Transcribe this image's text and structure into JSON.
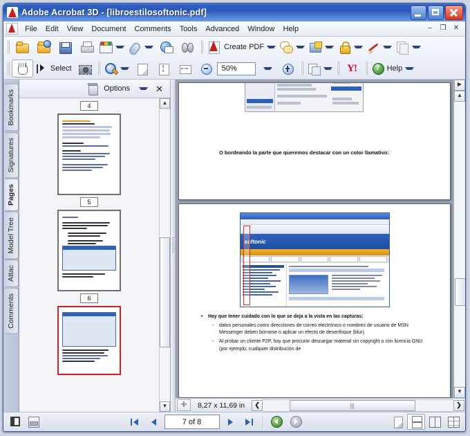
{
  "window": {
    "title": "Adobe Acrobat 3D - [libroestilosoftonic.pdf]",
    "app_icon": "acrobat-icon",
    "minimize": "–",
    "maximize": "□",
    "close": "✕",
    "mdi_minimize": "–",
    "mdi_restore": "❐",
    "mdi_close": "✕"
  },
  "menubar": {
    "items": [
      {
        "label": "File"
      },
      {
        "label": "Edit"
      },
      {
        "label": "View"
      },
      {
        "label": "Document"
      },
      {
        "label": "Comments"
      },
      {
        "label": "Tools"
      },
      {
        "label": "Advanced"
      },
      {
        "label": "Window"
      },
      {
        "label": "Help"
      }
    ]
  },
  "toolbar_file": {
    "buttons": [
      {
        "name": "open-button",
        "icon": "open-folder-icon",
        "label": ""
      },
      {
        "name": "organizer-button",
        "icon": "organizer-folder-icon",
        "label": ""
      },
      {
        "name": "save-button",
        "icon": "save-floppy-icon",
        "label": ""
      },
      {
        "name": "print-button",
        "icon": "printer-icon",
        "label": ""
      },
      {
        "name": "email-button",
        "icon": "email-icon",
        "label": ""
      },
      {
        "name": "attach-button",
        "icon": "paperclip-icon",
        "label": ""
      },
      {
        "name": "web-capture-button",
        "icon": "globe-icon",
        "label": ""
      },
      {
        "name": "search-button",
        "icon": "binoculars-icon",
        "label": ""
      }
    ],
    "create_pdf_label": "Create PDF",
    "tasks": [
      {
        "name": "review-and-comment-button",
        "icon": "review-comment-icon"
      },
      {
        "name": "stamp-button",
        "icon": "stamp-icon"
      },
      {
        "name": "secure-button",
        "icon": "lock-icon"
      },
      {
        "name": "sign-button",
        "icon": "pen-icon"
      },
      {
        "name": "forms-button",
        "icon": "forms-icon"
      }
    ]
  },
  "toolbar_view": {
    "hand_tool": {
      "name": "hand-tool",
      "icon": "hand-icon"
    },
    "select_label": "Select",
    "snapshot": {
      "name": "snapshot-tool",
      "icon": "camera-icon"
    },
    "zoom_tool": {
      "name": "zoom-in-tool",
      "icon": "magnifier-icon"
    },
    "actual_size": {
      "name": "actual-size-button",
      "icon": "page-icon"
    },
    "fit_page": {
      "name": "fit-page-button",
      "icon": "fit-page-icon"
    },
    "fit_width": {
      "name": "fit-width-button",
      "icon": "fit-width-icon"
    },
    "zoom_out": {
      "name": "zoom-out-button",
      "icon": "minus-circle-icon"
    },
    "zoom_value": "50%",
    "zoom_in": {
      "name": "zoom-in-button",
      "icon": "plus-circle-icon"
    },
    "page_setup": {
      "name": "page-setup-button",
      "icon": "pages-icon"
    },
    "yahoo": {
      "name": "yahoo-search-button",
      "icon": "yahoo-icon",
      "label": "Y!"
    },
    "help_label": "Help"
  },
  "nav_tabs": [
    {
      "label": "Bookmarks",
      "active": false
    },
    {
      "label": "Signatures",
      "active": false
    },
    {
      "label": "Pages",
      "active": true
    },
    {
      "label": "Model Tree",
      "active": false
    },
    {
      "label": "Attac",
      "active": false
    },
    {
      "label": "Comments",
      "active": false
    }
  ],
  "pages_panel": {
    "trash_icon": "trash-icon",
    "options_label": "Options",
    "close_label": "✕",
    "thumbnails": [
      {
        "page": "4",
        "selected": false
      },
      {
        "page": "5",
        "selected": false
      },
      {
        "page": "6",
        "selected": true
      }
    ]
  },
  "document": {
    "page1_text": "O bordeando la parte que queremos destacar con un color llamativo:",
    "page2_bullets": [
      {
        "level": 1,
        "marker": "•",
        "text": "Hay que tener cuidado con lo que se deja a la vista en las capturas:"
      },
      {
        "level": 2,
        "marker": "-",
        "text": "datos personales como direcciones de correo electrónico o nombres de usuario de MSN Messenger deben borrarse o aplicar un efecto de desenfoque (blur)."
      },
      {
        "level": 2,
        "marker": "-",
        "text": "Al probar un cliente P2P, hay que procurar descargar material sin copyright o con licencia GNU (por ejemplo, cualquier distribución de"
      }
    ],
    "embedded_site_name": "softonic",
    "page_size": "8,27 x 11,69 in"
  },
  "statusbar": {
    "nav_pane_button": {
      "name": "show-nav-pane-button",
      "icon": "nav-pane-icon"
    },
    "layers_button": {
      "name": "layers-button",
      "icon": "layers-icon"
    },
    "first_page": {
      "name": "first-page-button",
      "icon": "first-page-icon"
    },
    "prev_page": {
      "name": "previous-page-button",
      "icon": "previous-page-icon"
    },
    "page_indicator": "7 of 8",
    "next_page": {
      "name": "next-page-button",
      "icon": "next-page-icon"
    },
    "last_page": {
      "name": "last-page-button",
      "icon": "last-page-icon"
    },
    "previous_view": {
      "name": "previous-view-button",
      "icon": "previous-view-icon"
    },
    "next_view": {
      "name": "next-view-button",
      "icon": "next-view-icon"
    },
    "single_page": {
      "name": "single-page-layout-button",
      "icon": "single-page-icon"
    },
    "continuous": {
      "name": "continuous-layout-button",
      "icon": "continuous-icon",
      "active": true
    },
    "facing": {
      "name": "facing-layout-button",
      "icon": "facing-icon"
    },
    "continuous_facing": {
      "name": "continuous-facing-layout-button",
      "icon": "continuous-facing-icon"
    }
  },
  "colors": {
    "titlebar_blue": "#2f5fc0",
    "accent_red": "#cf2020",
    "panel_gray": "#eceff5",
    "doc_bg": "#9aa1b0"
  }
}
